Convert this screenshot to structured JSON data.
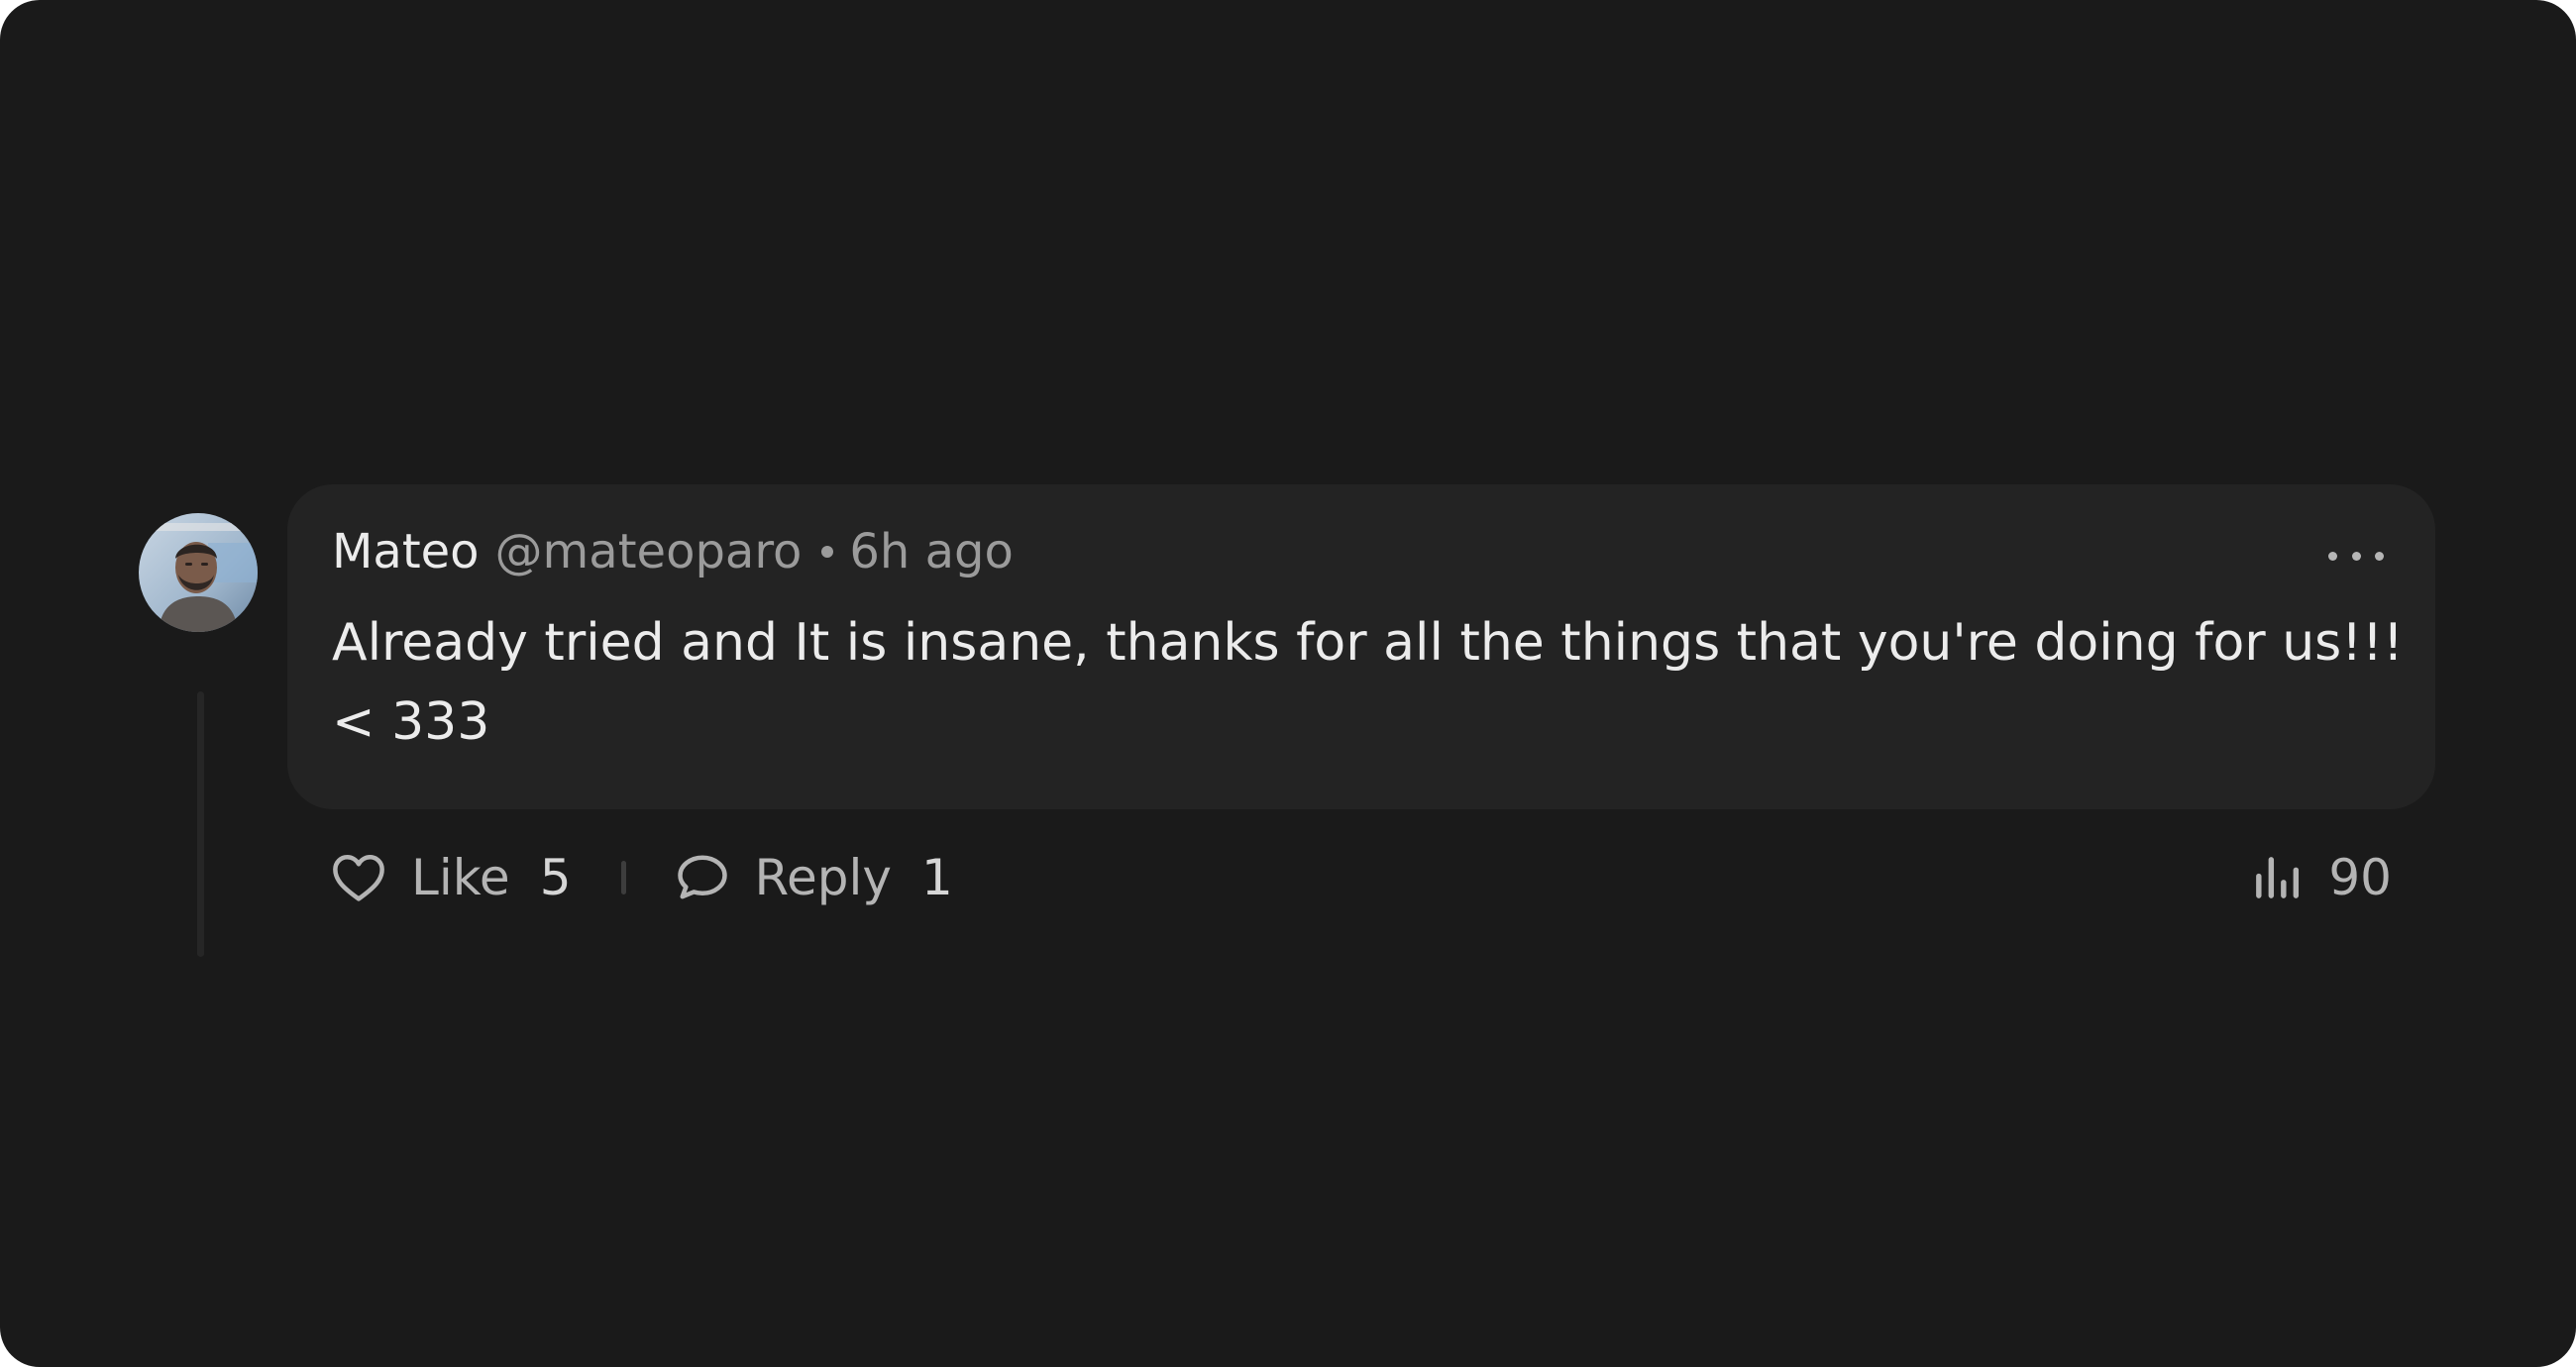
{
  "comment": {
    "author": {
      "name": "Mateo",
      "handle": "@mateoparo",
      "avatar_icon": "user-avatar-photo"
    },
    "time_ago": "6h ago",
    "body_lines": [
      "Already tried and It is insane, thanks for all the things that you're doing for us!!!",
      "< 333"
    ],
    "actions": {
      "like": {
        "label": "Like",
        "count": "5",
        "icon": "heart-icon"
      },
      "reply": {
        "label": "Reply",
        "count": "1",
        "icon": "speech-bubble-icon"
      },
      "more_icon": "more-horizontal-icon"
    },
    "views": {
      "count": "90",
      "icon": "bar-chart-icon"
    }
  },
  "colors": {
    "background": "#1a1a1a",
    "bubble": "#232323",
    "text_primary": "#ececec",
    "text_secondary": "#9b9b9b"
  }
}
